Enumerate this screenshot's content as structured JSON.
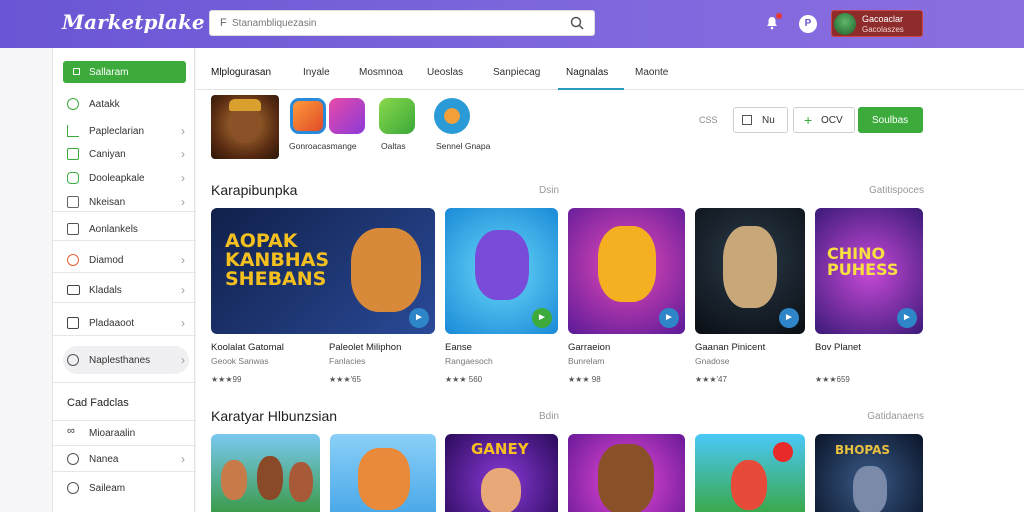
{
  "app": {
    "title": "Marketplake"
  },
  "search": {
    "icon_letter": "F",
    "placeholder": "Stanambliquezasin"
  },
  "account": {
    "name": "Gacoaclar",
    "sub": "Gacolaszes"
  },
  "help_glyph": "P",
  "sidebar": {
    "primary_button": "Sallaram",
    "items": [
      {
        "label": "Aatakk",
        "icon": "leaf-icon",
        "chevron": false
      },
      {
        "label": "Papleclarian",
        "icon": "chart-icon",
        "chevron": true
      },
      {
        "label": "Caniyan",
        "icon": "book-icon",
        "chevron": true
      },
      {
        "label": "Dooleapkale",
        "icon": "gamepad-icon",
        "chevron": true
      },
      {
        "label": "Nkeisan",
        "icon": "grid-icon",
        "chevron": true
      },
      {
        "label": "Aonlankels",
        "icon": "document-icon",
        "chevron": false
      },
      {
        "label": "Diamod",
        "icon": "target-icon",
        "chevron": true
      },
      {
        "label": "Kladals",
        "icon": "window-icon",
        "chevron": true
      },
      {
        "label": "Pladaaoot",
        "icon": "calendar-icon",
        "chevron": true
      },
      {
        "label": "Naplesthanes",
        "icon": "clock-icon",
        "chevron": true
      }
    ],
    "section_heading": "Cad Fadclas",
    "sub_items": [
      {
        "label": "Mioaraalin",
        "icon": "link-icon",
        "chevron": false
      },
      {
        "label": "Nanea",
        "icon": "pen-icon",
        "chevron": true
      },
      {
        "label": "Saileam",
        "icon": "gear-icon",
        "chevron": false
      }
    ]
  },
  "tabs": [
    "Mlplogurasan",
    "Inyale",
    "Mosmnoa",
    "Ueoslas",
    "Sanpiecag",
    "Nagnalas",
    "Maonte"
  ],
  "active_tab": 5,
  "shortcuts": [
    {
      "label": "",
      "color": "#7a3a18"
    },
    {
      "label": "Gonroacasmange",
      "color": "#ff7a2c"
    },
    {
      "label": "Oaltas",
      "color": "#5bb83c"
    },
    {
      "label": "Sennel Gnapa",
      "color": "#2a9ad8"
    }
  ],
  "controls": {
    "count": "CSS",
    "view_label": "Nu",
    "add_label": "OCV",
    "primary_label": "Soulbas"
  },
  "section1": {
    "title": "Karapibunpka",
    "mid": "Dsin",
    "right": "Gatitispoces",
    "cards": [
      {
        "title": "Koolalat Gatomal",
        "subtitle": "Geook Sanwas",
        "rating": "★★★99",
        "art_text": "AOPAK KANBHAS SHEBANS",
        "bg": "#1f3a78"
      },
      {
        "title": "Paleolet Miliphon",
        "subtitle": "Fanlacies",
        "rating": "★★★'65",
        "art_text": "",
        "bg": "#3bb4e8"
      },
      {
        "title": "Eanse",
        "subtitle": "Rangaesoch",
        "rating": "★★★ 560",
        "art_text": "",
        "bg": "#8a3ab8"
      },
      {
        "title": "Garraeion",
        "subtitle": "Bunrelam",
        "rating": "★★★ 98",
        "art_text": "",
        "bg": "#121820"
      },
      {
        "title": "Gaanan Pinicent",
        "subtitle": "Gnadose",
        "rating": "★★★'47",
        "art_text": "",
        "bg": "#6a2aa8"
      },
      {
        "title": "Bov Planet",
        "subtitle": "",
        "rating": "★★★659",
        "art_text": "CHINO PUHESS",
        "bg": "#7a2ab0"
      }
    ]
  },
  "section2": {
    "title": "Karatyar Hlbunzsian",
    "mid": "Bdin",
    "right": "Gatidanaens",
    "cards": [
      {
        "art_text": "",
        "bg": "#5ab0e0"
      },
      {
        "art_text": "",
        "bg": "#7ac8f0"
      },
      {
        "art_text": "GANEY",
        "bg": "#3a1a6a"
      },
      {
        "art_text": "",
        "bg": "#a83ab8"
      },
      {
        "art_text": "",
        "bg": "#3ab0e8"
      },
      {
        "art_text": "BHOPAS",
        "bg": "#1a2a48"
      }
    ]
  }
}
